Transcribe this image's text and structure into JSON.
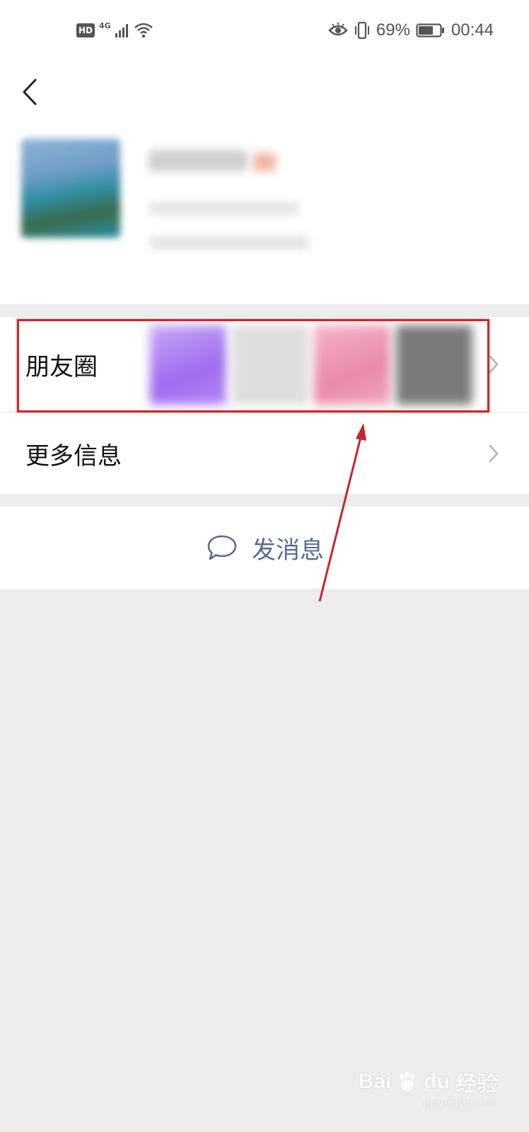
{
  "status_bar": {
    "hd_label": "HD",
    "network_label": "4G",
    "battery_percent": "69%",
    "time": "00:44",
    "battery_level": 0.69
  },
  "nav": {
    "back_icon": "chevron-left-icon"
  },
  "profile": {
    "avatar_icon": "profile-avatar"
  },
  "menu": {
    "moments_label": "朋友圈",
    "more_info_label": "更多信息",
    "chevron_icon": "chevron-right-icon"
  },
  "actions": {
    "send_message_label": "发消息",
    "send_message_icon": "chat-bubble-icon"
  },
  "watermark": {
    "brand": "Bai",
    "brand_du": "du",
    "suffix": "经验",
    "url": "jingyan.baidu.com"
  },
  "colors": {
    "link_blue": "#576b95",
    "highlight_red": "#d0262b",
    "background_gray": "#ededed"
  }
}
